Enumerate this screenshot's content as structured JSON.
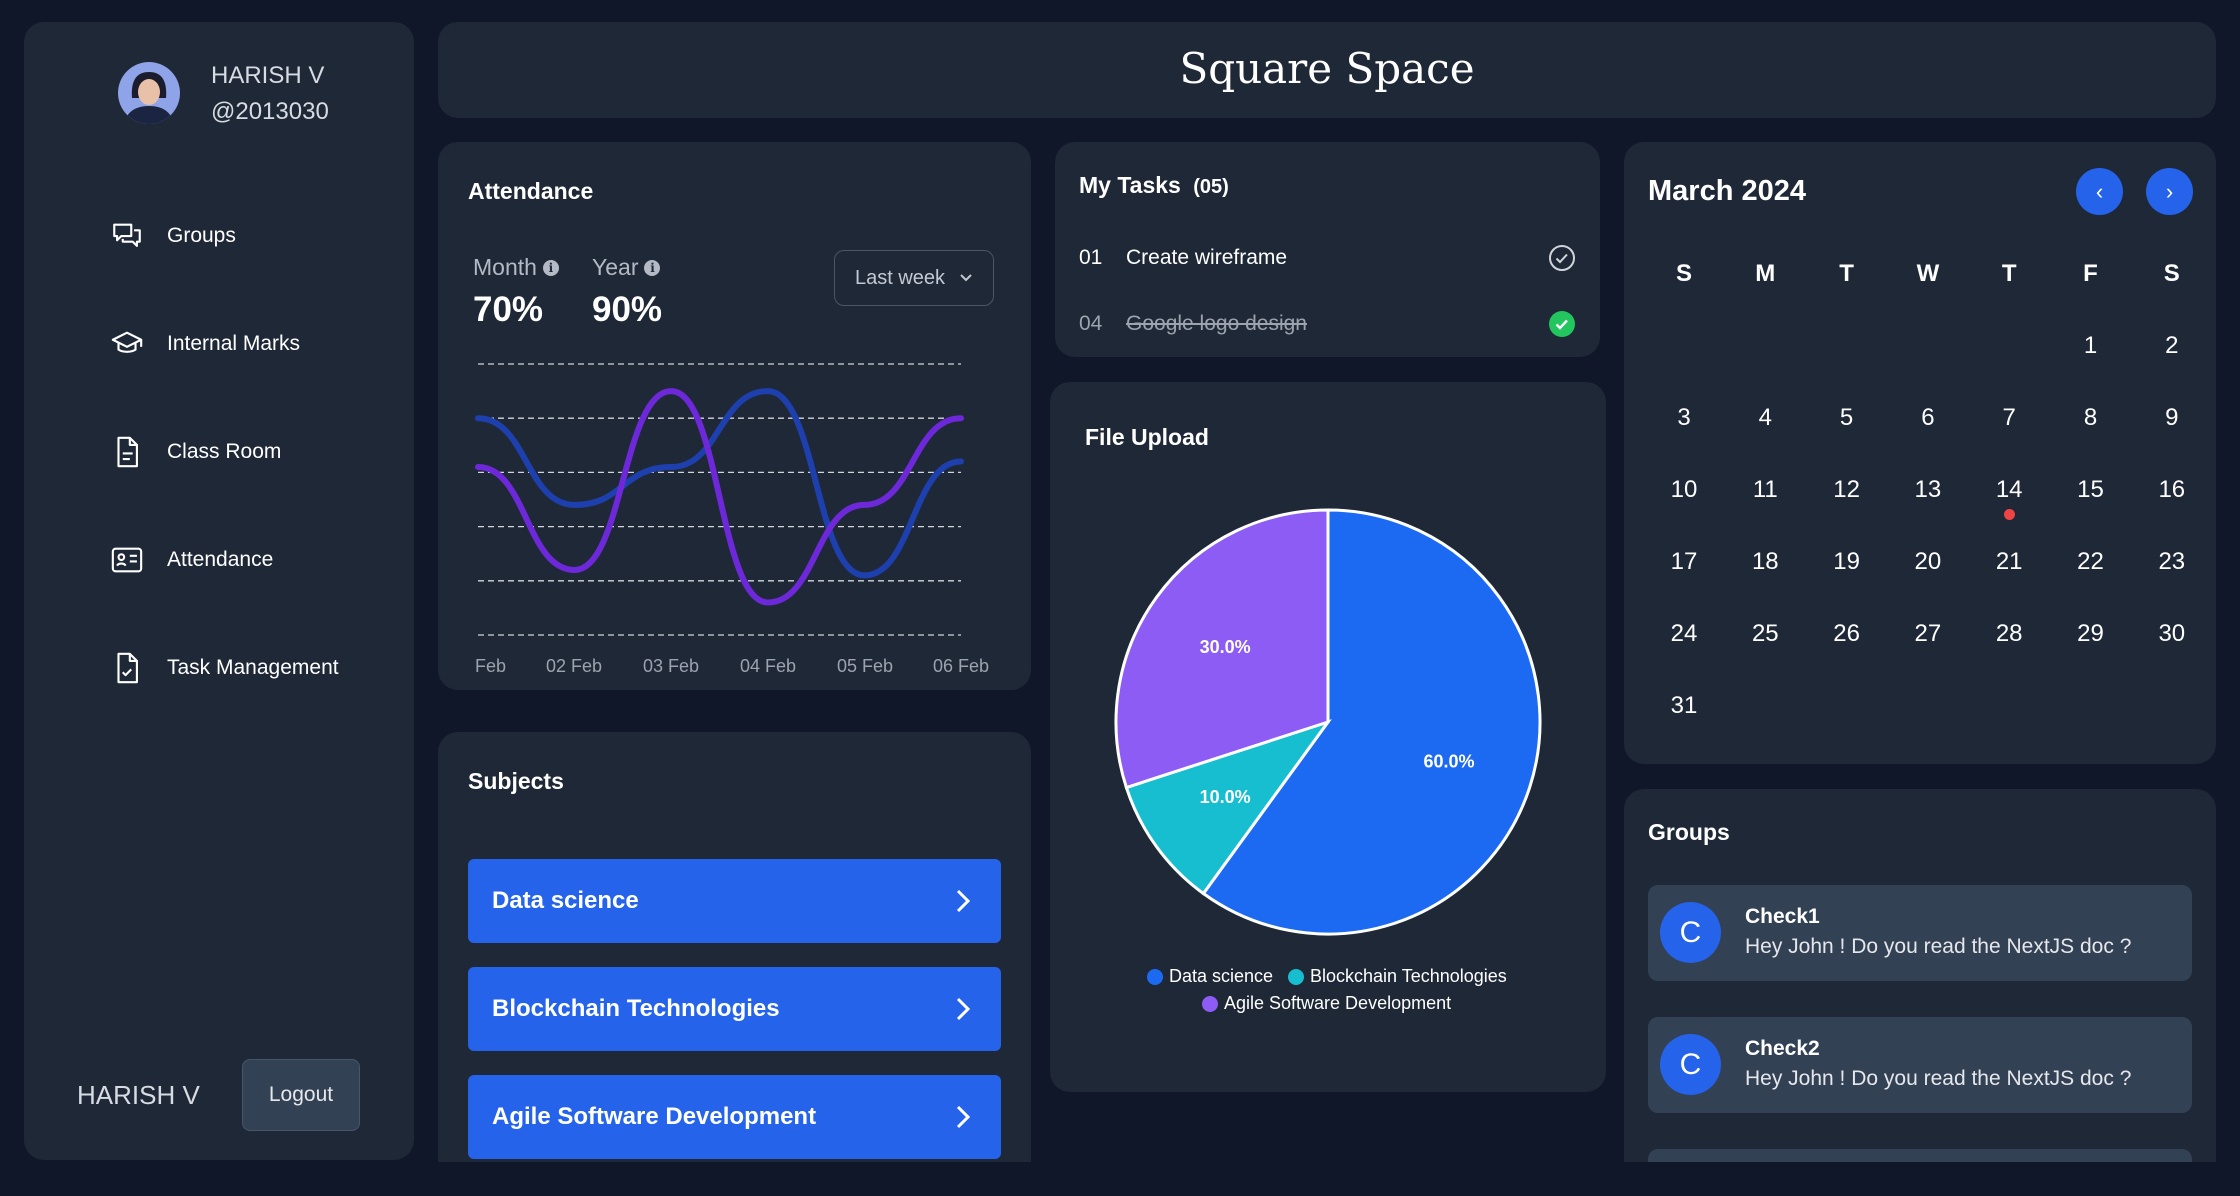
{
  "header": {
    "title": "Square Space"
  },
  "user": {
    "name": "HARISH V",
    "handle": "@2013030"
  },
  "sidebar": {
    "items": [
      {
        "label": "Groups",
        "icon": "chat-bubbles-icon"
      },
      {
        "label": "Internal Marks",
        "icon": "graduation-cap-icon"
      },
      {
        "label": "Class Room",
        "icon": "document-icon"
      },
      {
        "label": "Attendance",
        "icon": "id-card-icon"
      },
      {
        "label": "Task Management",
        "icon": "document-check-icon"
      }
    ],
    "footer_name": "HARISH V",
    "logout_label": "Logout"
  },
  "attendance": {
    "title": "Attendance",
    "month_label": "Month",
    "month_value": "70%",
    "year_label": "Year",
    "year_value": "90%",
    "range": "Last week",
    "x_labels": [
      "Feb",
      "02 Feb",
      "03 Feb",
      "04 Feb",
      "05 Feb",
      "06 Feb"
    ]
  },
  "chart_data": {
    "type": "line",
    "x": [
      "Feb",
      "02 Feb",
      "03 Feb",
      "04 Feb",
      "05 Feb",
      "06 Feb"
    ],
    "ylim": [
      0,
      5
    ],
    "grid": true,
    "series": [
      {
        "color": "#1e40af",
        "values": [
          4,
          2.4,
          3.1,
          4.5,
          1.1,
          3.2
        ]
      },
      {
        "color": "#6d28d9",
        "values": [
          3.1,
          1.2,
          4.5,
          0.6,
          2.4,
          4
        ]
      }
    ]
  },
  "subjects": {
    "title": "Subjects",
    "items": [
      "Data science",
      "Blockchain Technologies",
      "Agile Software Development"
    ]
  },
  "tasks": {
    "title": "My Tasks",
    "count": "(05)",
    "items": [
      {
        "num": "01",
        "text": "Create wireframe",
        "done": false
      },
      {
        "num": "04",
        "text": "Google logo design",
        "done": true
      }
    ]
  },
  "file_upload": {
    "title": "File Upload",
    "slices": [
      {
        "label": "Data science",
        "value": 60,
        "pct": "60.0%",
        "color": "#1d6af2"
      },
      {
        "label": "Blockchain Technologies",
        "value": 10,
        "pct": "10.0%",
        "color": "#17becf"
      },
      {
        "label": "Agile Software Development",
        "value": 30,
        "pct": "30.0%",
        "color": "#8c5cf5"
      }
    ]
  },
  "calendar": {
    "month": "March 2024",
    "prev": "‹",
    "next": "›",
    "weekdays": [
      "S",
      "M",
      "T",
      "W",
      "T",
      "F",
      "S"
    ],
    "start_offset": 5,
    "days": 31,
    "event_days": [
      14
    ]
  },
  "groups": {
    "title": "Groups",
    "items": [
      {
        "initial": "C",
        "name": "Check1",
        "message": "Hey John ! Do you read the NextJS doc ?"
      },
      {
        "initial": "C",
        "name": "Check2",
        "message": "Hey John ! Do you read the NextJS doc ?"
      }
    ]
  }
}
